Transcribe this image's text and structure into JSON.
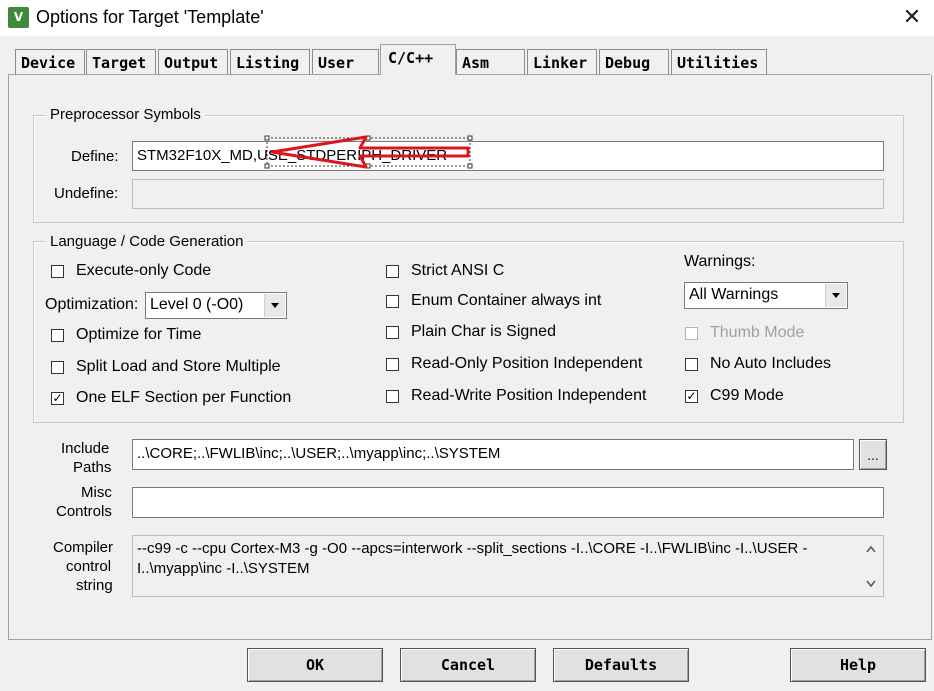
{
  "window": {
    "title": "Options for Target 'Template'",
    "icon_glyph": "V",
    "close_glyph": "✕"
  },
  "tabs": [
    "Device",
    "Target",
    "Output",
    "Listing",
    "User",
    "C/C++",
    "Asm",
    "Linker",
    "Debug",
    "Utilities"
  ],
  "active_tab": "C/C++",
  "preprocessor": {
    "legend": "Preprocessor Symbols",
    "define_label": "Define:",
    "define_value_1": "STM32F10X_MD,",
    "define_value_2": "USE_STDPERIPH_DRIVER",
    "undefine_label": "Undefine:",
    "undefine_value": ""
  },
  "language": {
    "legend": "Language / Code Generation",
    "execute_only": {
      "label": "Execute-only Code",
      "checked": false
    },
    "optimization_label": "Optimization:",
    "optimization_value": "Level 0 (-O0)",
    "optimize_time": {
      "label": "Optimize for Time",
      "checked": false
    },
    "split_load": {
      "label": "Split Load and Store Multiple",
      "checked": false
    },
    "one_elf": {
      "label": "One ELF Section per Function",
      "checked": true
    },
    "strict_ansi": {
      "label": "Strict ANSI C",
      "checked": false
    },
    "enum_container": {
      "label": "Enum Container always int",
      "checked": false
    },
    "plain_char": {
      "label": "Plain Char is Signed",
      "checked": false
    },
    "ro_pos": {
      "label": "Read-Only Position Independent",
      "checked": false
    },
    "rw_pos": {
      "label": "Read-Write Position Independent",
      "checked": false
    },
    "warnings_label": "Warnings:",
    "warnings_value": "All Warnings",
    "thumb_mode": {
      "label": "Thumb Mode",
      "checked": false,
      "disabled": true
    },
    "no_auto_includes": {
      "label": "No Auto Includes",
      "checked": false
    },
    "c99_mode": {
      "label": "C99 Mode",
      "checked": true
    }
  },
  "include_paths": {
    "label_1": "Include",
    "label_2": "Paths",
    "value": "..\\CORE;..\\FWLIB\\inc;..\\USER;..\\myapp\\inc;..\\SYSTEM",
    "browse_label": "..."
  },
  "misc_controls": {
    "label_1": "Misc",
    "label_2": "Controls",
    "value": ""
  },
  "compiler_control": {
    "label_1": "Compiler",
    "label_2": "control",
    "label_3": "string",
    "line_1": "--c99 -c --cpu Cortex-M3 -g -O0 --apcs=interwork --split_sections -I..\\CORE -I..\\FWLIB\\inc -I..\\USER -",
    "line_2": "I..\\myapp\\inc -I..\\SYSTEM"
  },
  "buttons": {
    "ok": "OK",
    "cancel": "Cancel",
    "defaults": "Defaults",
    "help": "Help"
  },
  "check_glyph": "✓",
  "colors": {
    "annotation_red": "#e0141e",
    "dialog_bg": "#f0f0f0",
    "icon_green": "#3f8a3a"
  }
}
